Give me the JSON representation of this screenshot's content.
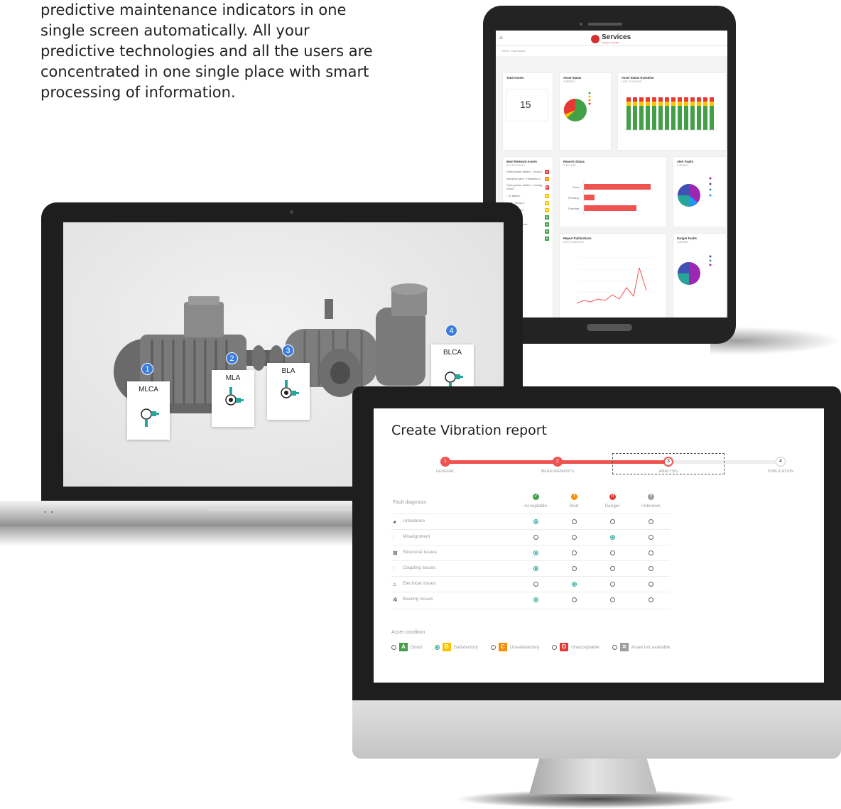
{
  "intro": {
    "lines": [
      "predictive maintenance indicators in one",
      "single screen automatically. All your",
      "predictive technologies and all the users are",
      "concentrated in one single place with smart",
      "processing of information."
    ]
  },
  "tablet": {
    "brand": "Services",
    "brand_sub": "company example",
    "breadcrumb": "Home  ›  Dashboard",
    "total_assets": {
      "title": "Total Assets",
      "value": "15"
    },
    "asset_status": {
      "title": "Asset Status",
      "sub": "CURRENT"
    },
    "asset_status_evolution": {
      "title": "Asset Status Evolution",
      "sub": "LAST 12 MONTHS"
    },
    "most_relevant": {
      "title": "Most Relevant Assets",
      "sub": "BY CRITICALITY",
      "items": [
        {
          "label": "Hydro power station - Group 2",
          "grade": "D",
          "color": "#e53935"
        },
        {
          "label": "Industrial plant - Hidráulico 4",
          "grade": "C",
          "color": "#fb8c00"
        },
        {
          "label": "Hydro power station - Cooling circuit",
          "grade": "D",
          "color": "#e53935"
        },
        {
          "label": "...er station -",
          "grade": "B",
          "color": "#f9c300"
        },
        {
          "label": "...ant - Group 2",
          "grade": "B",
          "color": "#f9c300"
        },
        {
          "label": "...ant - Group 1",
          "grade": "B",
          "color": "#f9c300"
        },
        {
          "label": "...r station -",
          "grade": "A",
          "color": "#43a047"
        },
        {
          "label": "...r station - ...mer",
          "grade": "A",
          "color": "#43a047"
        },
        {
          "label": "...wind turbine",
          "grade": "A",
          "color": "#43a047"
        },
        {
          "label": "...Solar panel",
          "grade": "A",
          "color": "#43a047"
        }
      ]
    },
    "reports_status": {
      "title": "Reports Status",
      "sub": "THIS YEAR",
      "bars": [
        {
          "label": "Done",
          "value": 19
        },
        {
          "label": "Pending",
          "value": 3
        },
        {
          "label": "Overdue",
          "value": 15
        }
      ]
    },
    "alert_faults": {
      "title": "Alert Faults",
      "sub": "CURRENT"
    },
    "report_publications": {
      "title": "Report Publications",
      "sub": "LAST 12 MONTHS"
    },
    "danger_faults": {
      "title": "Danger Faults",
      "sub": "CURRENT"
    }
  },
  "laptop": {
    "sensors": [
      {
        "num": "1",
        "label": "MLCA"
      },
      {
        "num": "2",
        "label": "MLA"
      },
      {
        "num": "3",
        "label": "BLA"
      },
      {
        "num": "4",
        "label": "BLCA"
      }
    ]
  },
  "report": {
    "title": "Create Vibration report",
    "steps": [
      {
        "num": "1",
        "label": "GENERAL"
      },
      {
        "num": "2",
        "label": "MEASUREMENTS"
      },
      {
        "num": "3",
        "label": "ANALYSIS"
      },
      {
        "num": "4",
        "label": "PUBLICATION"
      }
    ],
    "fault_header": "Fault diagnosis",
    "columns": [
      {
        "label": "Acceptable",
        "color": "#43a047",
        "icon": "check-icon"
      },
      {
        "label": "Alert",
        "color": "#fb8c00",
        "icon": "alert-icon"
      },
      {
        "label": "Danger",
        "color": "#e53935",
        "icon": "danger-icon"
      },
      {
        "label": "Unknown",
        "color": "#9e9e9e",
        "icon": "question-icon"
      }
    ],
    "rows": [
      {
        "label": "Unbalance",
        "icon": "unbalance-icon",
        "selected": 0
      },
      {
        "label": "Misalignment",
        "icon": "misalignment-icon",
        "selected": 2
      },
      {
        "label": "Structural issues",
        "icon": "structural-icon",
        "selected": 0
      },
      {
        "label": "Coupling issues",
        "icon": "coupling-icon",
        "selected": 0
      },
      {
        "label": "Electrical issues",
        "icon": "electrical-icon",
        "selected": 1
      },
      {
        "label": "Bearing issues",
        "icon": "bearing-icon",
        "selected": 0
      }
    ],
    "asset_condition_label": "Asset condition",
    "conditions": [
      {
        "letter": "A",
        "label": "Good",
        "color": "#43a047",
        "selected": false
      },
      {
        "letter": "B",
        "label": "Satisfactory",
        "color": "#f9c300",
        "selected": true
      },
      {
        "letter": "C",
        "label": "Unsatisfactory",
        "color": "#fb8c00",
        "selected": false
      },
      {
        "letter": "D",
        "label": "Unacceptable",
        "color": "#e53935",
        "selected": false
      },
      {
        "letter": "✕",
        "label": "Asset not available",
        "color": "#9e9e9e",
        "selected": false
      }
    ]
  }
}
